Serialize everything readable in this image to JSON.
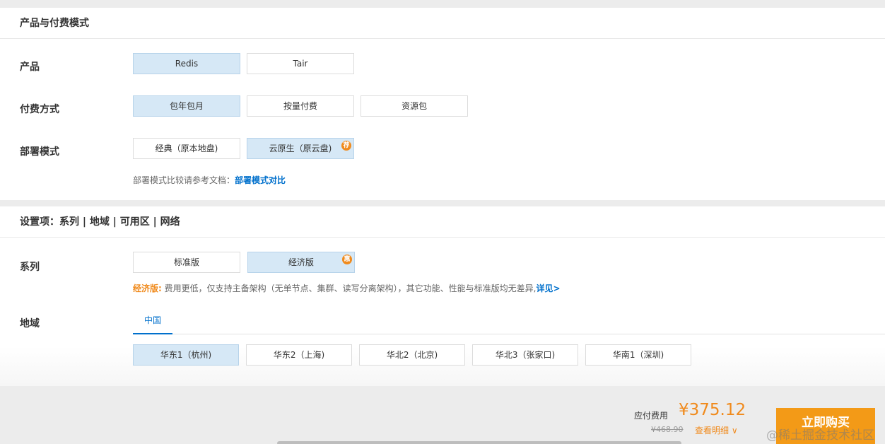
{
  "section1": {
    "title": "产品与付费模式",
    "product": {
      "label": "产品",
      "options": [
        "Redis",
        "Tair"
      ]
    },
    "payment": {
      "label": "付费方式",
      "options": [
        "包年包月",
        "按量付费",
        "资源包"
      ]
    },
    "deploy": {
      "label": "部署模式",
      "options": [
        "经典（原本地盘)",
        "云原生（原云盘)"
      ],
      "badge": "荐",
      "note": "部署模式比较请参考文档：",
      "note_link": "部署模式对比"
    }
  },
  "section2": {
    "title": "设置项：系列 | 地域 | 可用区 | 网络",
    "series": {
      "label": "系列",
      "options": [
        "标准版",
        "经济版"
      ],
      "badge": "惠",
      "note_prefix": "经济版:",
      "note_text": " 费用更低，仅支持主备架构（无单节点、集群、读写分离架构），其它功能、性能与标准版均无差异,",
      "note_link": "详见>"
    },
    "region": {
      "label": "地域",
      "tab": "中国",
      "options": [
        "华东1（杭州)",
        "华东2（上海)",
        "华北2（北京)",
        "华北3（张家口)",
        "华南1（深圳)"
      ]
    }
  },
  "footer": {
    "fee_label": "应付费用",
    "price": "¥375.12",
    "original_price": "¥468.90",
    "detail_label": "查看明细 ∨",
    "buy_label": "立即购买",
    "watermark": "@稀土掘金技术社区"
  },
  "colors": {
    "accent": "#f08a1c",
    "link": "#0070cc",
    "selected_bg": "#d6e8f6"
  }
}
